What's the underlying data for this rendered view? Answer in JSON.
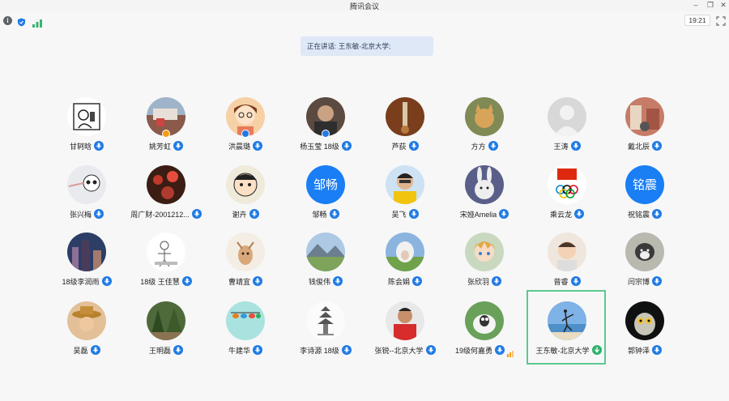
{
  "window": {
    "title": "腾讯会议"
  },
  "toolbar": {
    "time": "19:21"
  },
  "banner": {
    "speaking": "正在讲话: 王东敏-北京大学;"
  },
  "participants": [
    {
      "name": "甘轲晗",
      "avatar": "photo-sketch",
      "host": false
    },
    {
      "name": "姚芳虹",
      "avatar": "photo-landscape",
      "host": true
    },
    {
      "name": "洪晨璐",
      "avatar": "photo-cartoon",
      "host": true
    },
    {
      "name": "杨玉莹 18级",
      "avatar": "photo-person",
      "host": true
    },
    {
      "name": "芦荻",
      "avatar": "photo-instrument",
      "host": false
    },
    {
      "name": "方方",
      "avatar": "photo-cat",
      "host": false
    },
    {
      "name": "王涛",
      "avatar": "default-avatar",
      "host": false
    },
    {
      "name": "戴北辰",
      "avatar": "photo-street",
      "host": false
    },
    {
      "name": "张兴梅",
      "avatar": "photo-panda",
      "host": false
    },
    {
      "name": "周广财-2001212...",
      "avatar": "photo-lanterns",
      "host": false
    },
    {
      "name": "谢卉",
      "avatar": "photo-cartoon-boy",
      "host": false
    },
    {
      "name": "邹畅",
      "avatar": "text",
      "avatar_text": "邹畅",
      "host": false
    },
    {
      "name": "吴飞",
      "avatar": "photo-boy",
      "host": false
    },
    {
      "name": "宋娅Amelia",
      "avatar": "photo-rabbit",
      "host": false
    },
    {
      "name": "乘云龙",
      "avatar": "photo-olympic",
      "host": false
    },
    {
      "name": "祝铭震",
      "avatar": "text",
      "avatar_text": "铭震",
      "host": false
    },
    {
      "name": "18级李润雨",
      "avatar": "photo-city",
      "host": false
    },
    {
      "name": "18级 王佳慧",
      "avatar": "photo-doodle",
      "host": false
    },
    {
      "name": "曹靖宜",
      "avatar": "photo-deer",
      "host": false
    },
    {
      "name": "钱俊伟",
      "avatar": "photo-mountain",
      "host": false
    },
    {
      "name": "陈会娟",
      "avatar": "photo-sheep",
      "host": false
    },
    {
      "name": "张欣羽",
      "avatar": "photo-anime",
      "host": false
    },
    {
      "name": "曾睿",
      "avatar": "photo-child",
      "host": false
    },
    {
      "name": "闫宗博",
      "avatar": "photo-dog",
      "host": false
    },
    {
      "name": "吴磊",
      "avatar": "photo-hat",
      "host": false
    },
    {
      "name": "王明磊",
      "avatar": "photo-trees",
      "host": false
    },
    {
      "name": "牛建华",
      "avatar": "photo-birds",
      "host": false
    },
    {
      "name": "李诗源 18级",
      "avatar": "photo-pagoda",
      "host": false
    },
    {
      "name": "张锐--北京大学",
      "avatar": "photo-athlete",
      "host": false
    },
    {
      "name": "19级何嘉勇",
      "avatar": "photo-sheep-cartoon",
      "host": false,
      "volume": true
    },
    {
      "name": "王东敏-北京大学",
      "avatar": "photo-beach",
      "host": false,
      "active": true
    },
    {
      "name": "郭钟泽",
      "avatar": "photo-owl",
      "host": false
    }
  ],
  "colors": {
    "accent": "#1f7ae5",
    "active_border": "#5bc98f",
    "banner_bg": "#dfe8f7"
  }
}
